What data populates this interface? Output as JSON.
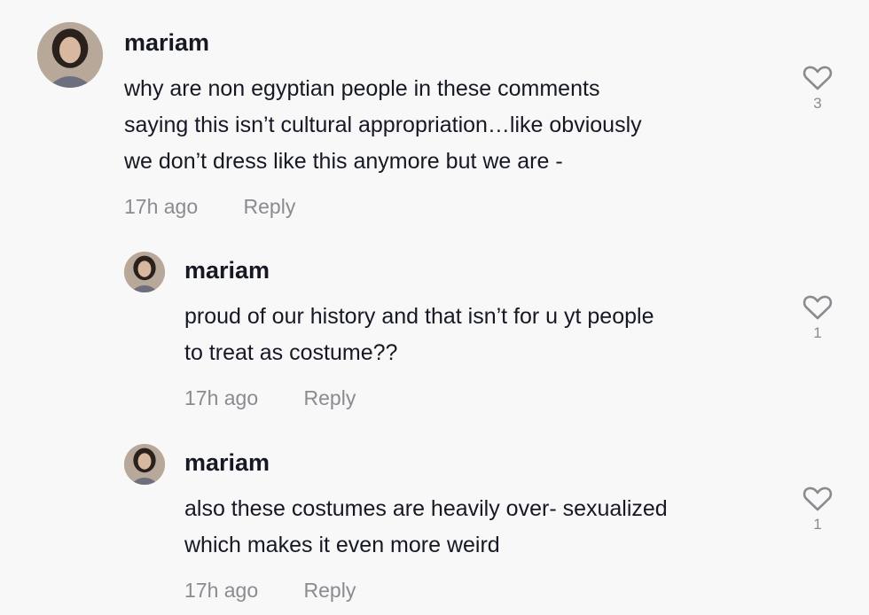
{
  "comments": [
    {
      "username": "mariam",
      "lines": [
        "why are non egyptian people in these comments",
        "saying this isn’t cultural appropriation…like obviously",
        "we don’t dress like this anymore but we are -"
      ],
      "time": "17h ago",
      "reply_label": "Reply",
      "like_count": "3"
    },
    {
      "username": "mariam",
      "lines": [
        "proud of our history and that isn’t for u yt people",
        "to treat as costume??"
      ],
      "time": "17h ago",
      "reply_label": "Reply",
      "like_count": "1"
    },
    {
      "username": "mariam",
      "lines": [
        "also these costumes are heavily over- sexualized",
        "which makes it even more weird"
      ],
      "time": "17h ago",
      "reply_label": "Reply",
      "like_count": "1"
    }
  ],
  "icons": {
    "like": "heart-outline-icon",
    "avatar": "profile-photo"
  },
  "colors": {
    "text": "#161823",
    "muted": "#8a8b91",
    "background": "#f8f8f8"
  }
}
